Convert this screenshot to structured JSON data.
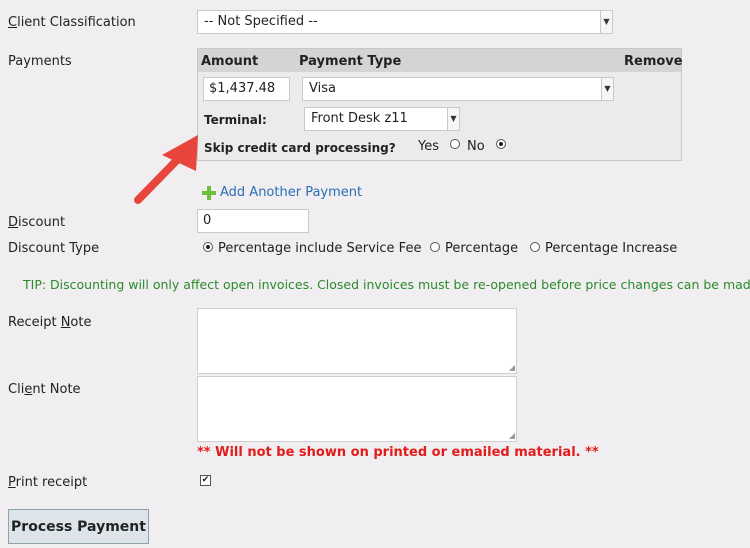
{
  "client_classification": {
    "label_first": "C",
    "label_rest": "lient Classification",
    "value": "-- Not Specified --"
  },
  "payments": {
    "label": "Payments",
    "headers": {
      "amount": "Amount",
      "payment_type": "Payment Type",
      "remove": "Remove"
    },
    "amount_value": "$1,437.48",
    "payment_type_value": "Visa",
    "terminal_label": "Terminal:",
    "terminal_value": "Front Desk z11",
    "skip_label": "Skip credit card processing?",
    "skip_yes": "Yes",
    "skip_no": "No",
    "skip_selected": "No",
    "add_another": "Add Another Payment"
  },
  "discount": {
    "label_first": "D",
    "label_rest": "iscount",
    "value": "0"
  },
  "discount_type": {
    "label": "Discount Type",
    "options": [
      "Percentage include Service Fee",
      "Percentage",
      "Percentage Increase"
    ],
    "selected": "Percentage include Service Fee"
  },
  "tip_text": "TIP: Discounting will only affect open invoices. Closed invoices must be re-opened before price changes can be made.",
  "receipt_note": {
    "label_before": "Receipt ",
    "label_ul": "N",
    "label_after": "ote"
  },
  "client_note": {
    "label_before": "Cli",
    "label_ul": "e",
    "label_after": "nt Note"
  },
  "warning_text": "** Will not be shown on printed or emailed material. **",
  "print_receipt": {
    "label_first": "P",
    "label_rest": "rint receipt",
    "checked": true,
    "check_glyph": "✔"
  },
  "process_button": "Process Payment",
  "colors": {
    "background": "#f0eef0",
    "link": "#2a6fb3",
    "tip": "#2c8a2c",
    "warning": "#e21b1b",
    "arrow": "#e8453c",
    "plus_icon": "#6fbf3b"
  }
}
